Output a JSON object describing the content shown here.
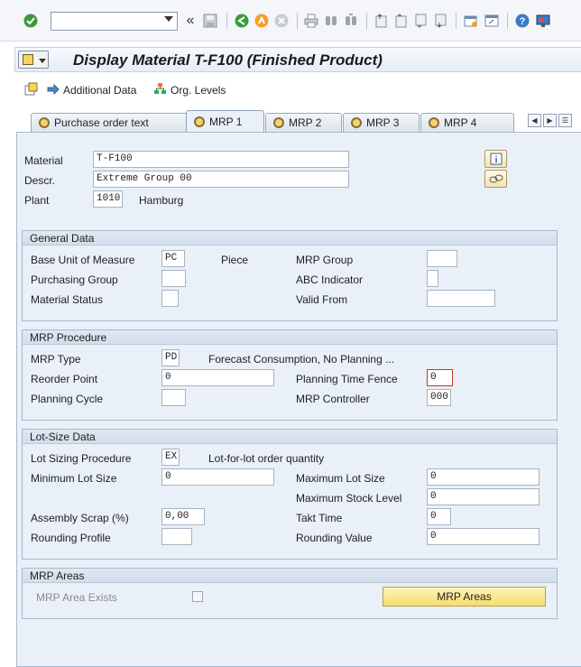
{
  "colors": {
    "accent": "#f5dd6c",
    "panel": "#e9f0f8",
    "focus": "#c0392b"
  },
  "toolbar": {
    "command_field": "",
    "icons": [
      "enter-icon",
      "command-dropdown",
      "back-nav-icon",
      "save-icon",
      "back-icon",
      "exit-icon",
      "cancel-icon",
      "print-icon",
      "find-icon",
      "find-next-icon",
      "first-page-icon",
      "previous-page-icon",
      "next-page-icon",
      "last-page-icon",
      "create-session-icon",
      "shortcut-icon",
      "help-icon",
      "customize-layout-icon"
    ]
  },
  "title": "Display Material T-F100 (Finished Product)",
  "appbar": {
    "additional_data": "Additional Data",
    "org_levels": "Org. Levels"
  },
  "tabs": [
    "Purchase order text",
    "MRP 1",
    "MRP 2",
    "MRP 3",
    "MRP 4"
  ],
  "active_tab": "MRP 1",
  "header": {
    "material_label": "Material",
    "material_value": "T-F100",
    "descr_label": "Descr.",
    "descr_value": "Extreme Group 00",
    "plant_label": "Plant",
    "plant_value": "1010",
    "plant_name": "Hamburg"
  },
  "general_data": {
    "title": "General Data",
    "base_uom_label": "Base Unit of Measure",
    "base_uom_value": "PC",
    "base_uom_text": "Piece",
    "mrp_group_label": "MRP Group",
    "mrp_group_value": "",
    "purch_group_label": "Purchasing Group",
    "purch_group_value": "",
    "abc_label": "ABC Indicator",
    "abc_value": "",
    "mat_status_label": "Material Status",
    "mat_status_value": "",
    "valid_from_label": "Valid From",
    "valid_from_value": ""
  },
  "mrp_procedure": {
    "title": "MRP Procedure",
    "mrp_type_label": "MRP Type",
    "mrp_type_value": "PD",
    "mrp_type_text": "Forecast Consumption, No Planning ...",
    "reorder_label": "Reorder Point",
    "reorder_value": "0",
    "ptf_label": "Planning Time Fence",
    "ptf_value": "0",
    "cycle_label": "Planning Cycle",
    "cycle_value": "",
    "controller_label": "MRP Controller",
    "controller_value": "000"
  },
  "lot_size": {
    "title": "Lot-Size Data",
    "proc_label": "Lot Sizing Procedure",
    "proc_value": "EX",
    "proc_text": "Lot-for-lot order quantity",
    "min_label": "Minimum Lot Size",
    "min_value": "0",
    "max_label": "Maximum Lot Size",
    "max_value": "0",
    "max_stock_label": "Maximum Stock Level",
    "max_stock_value": "0",
    "scrap_label": "Assembly Scrap (%)",
    "scrap_value": "0,00",
    "takt_label": "Takt Time",
    "takt_value": "0",
    "rprofile_label": "Rounding Profile",
    "rprofile_value": "",
    "rvalue_label": "Rounding Value",
    "rvalue_value": "0"
  },
  "mrp_areas": {
    "title": "MRP Areas",
    "exists_label": "MRP Area Exists",
    "exists_checked": false,
    "button": "MRP Areas"
  }
}
